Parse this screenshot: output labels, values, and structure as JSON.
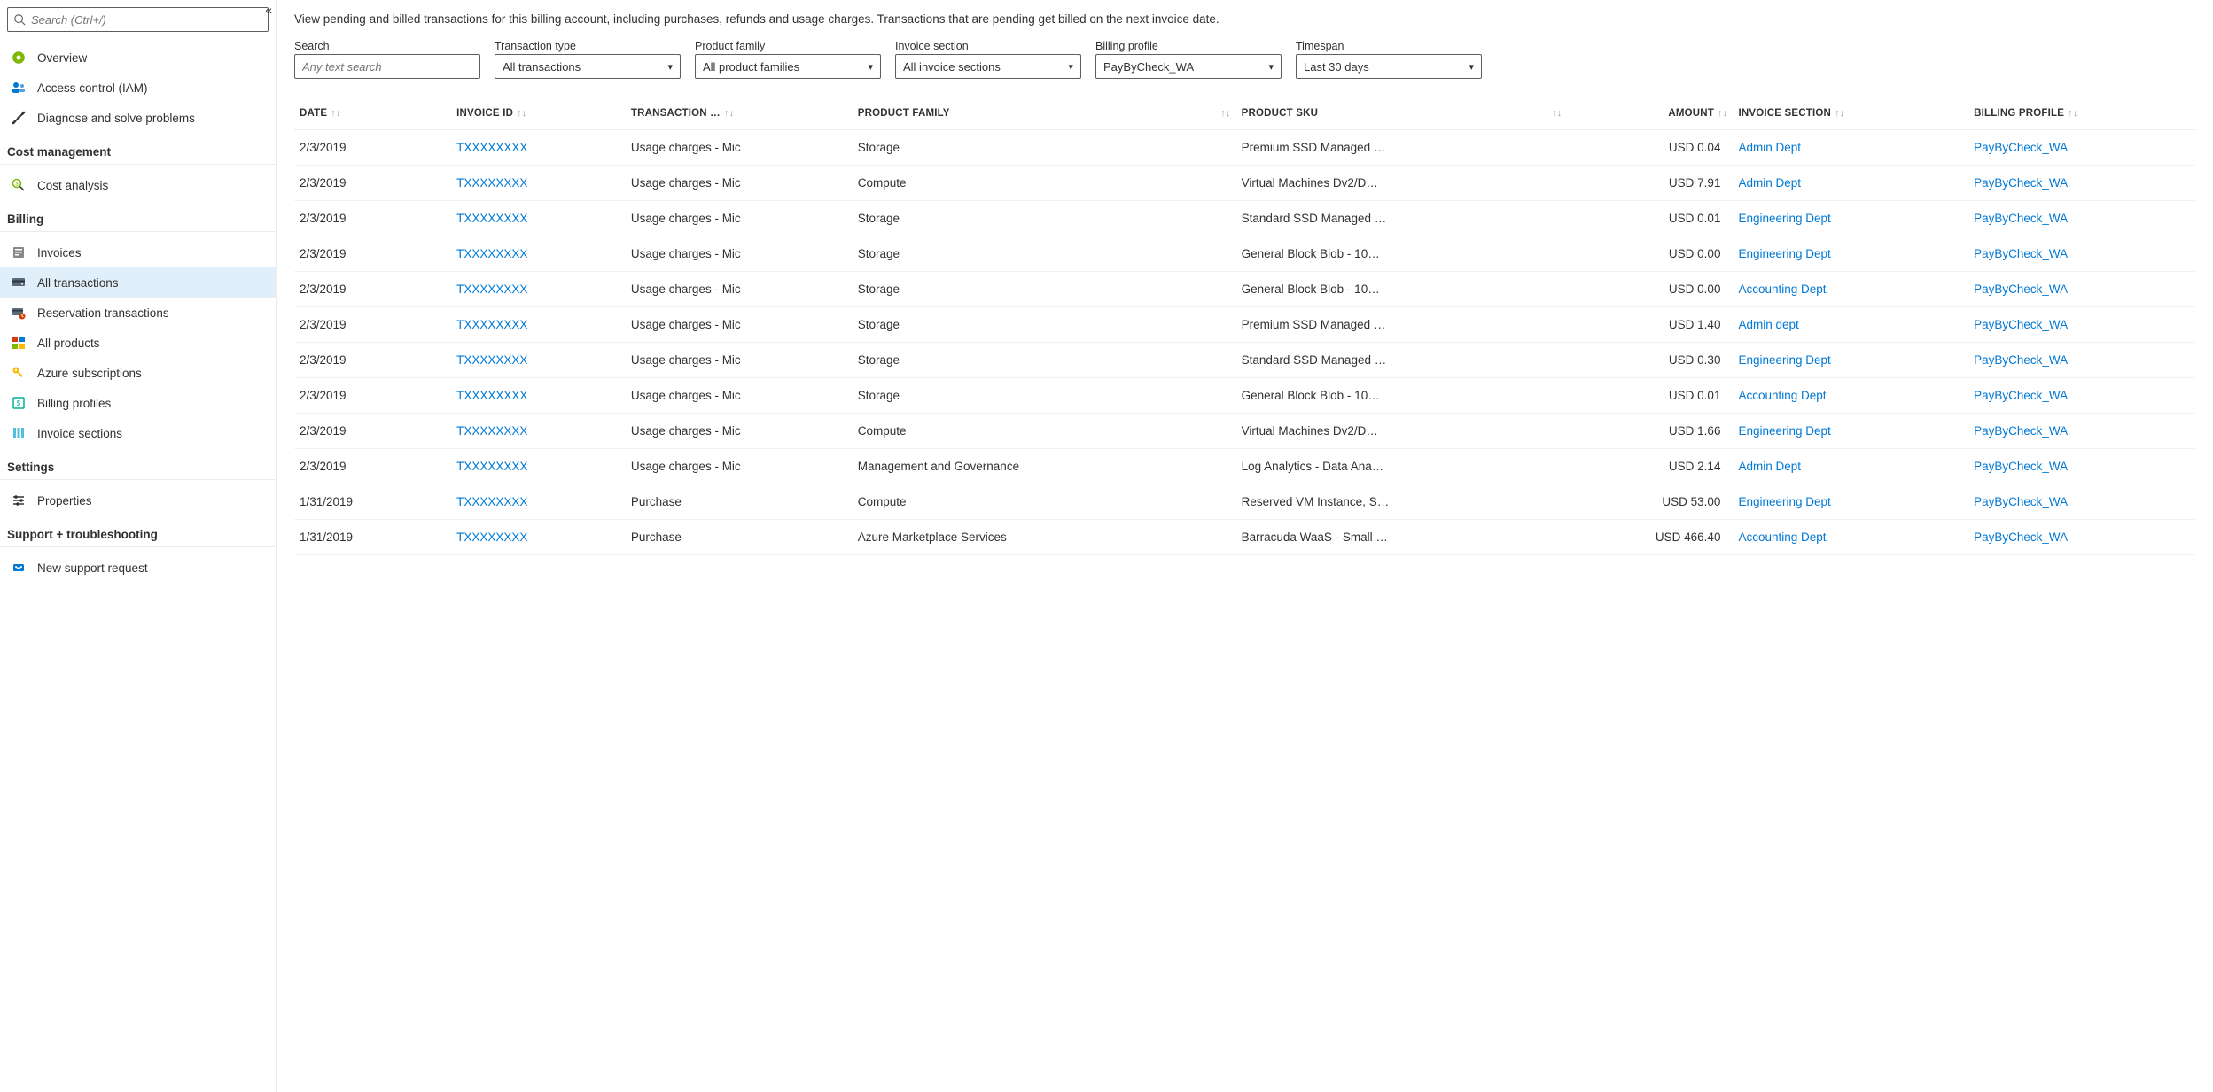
{
  "sidebar": {
    "search_placeholder": "Search (Ctrl+/)",
    "top_items": [
      {
        "label": "Overview"
      },
      {
        "label": "Access control (IAM)"
      },
      {
        "label": "Diagnose and solve problems"
      }
    ],
    "sections": [
      {
        "header": "Cost management",
        "items": [
          {
            "label": "Cost analysis"
          }
        ]
      },
      {
        "header": "Billing",
        "items": [
          {
            "label": "Invoices"
          },
          {
            "label": "All transactions",
            "active": true
          },
          {
            "label": "Reservation transactions"
          },
          {
            "label": "All products"
          },
          {
            "label": "Azure subscriptions"
          },
          {
            "label": "Billing profiles"
          },
          {
            "label": "Invoice sections"
          }
        ]
      },
      {
        "header": "Settings",
        "items": [
          {
            "label": "Properties"
          }
        ]
      },
      {
        "header": "Support + troubleshooting",
        "items": [
          {
            "label": "New support request"
          }
        ]
      }
    ]
  },
  "main": {
    "description": "View pending and billed transactions for this billing account, including purchases, refunds and usage charges. Transactions that are pending get billed on the next invoice date.",
    "filters": {
      "search_label": "Search",
      "search_placeholder": "Any text search",
      "transaction_type_label": "Transaction type",
      "transaction_type_value": "All transactions",
      "product_family_label": "Product family",
      "product_family_value": "All product families",
      "invoice_section_label": "Invoice section",
      "invoice_section_value": "All invoice sections",
      "billing_profile_label": "Billing profile",
      "billing_profile_value": "PayByCheck_WA",
      "timespan_label": "Timespan",
      "timespan_value": "Last 30 days"
    },
    "columns": [
      "DATE",
      "INVOICE ID",
      "TRANSACTION …",
      "PRODUCT FAMILY",
      "PRODUCT SKU",
      "AMOUNT",
      "INVOICE SECTION",
      "BILLING PROFILE"
    ],
    "rows": [
      {
        "date": "2/3/2019",
        "invoice_id": "TXXXXXXXX",
        "transaction": "Usage charges - Mic",
        "product_family": "Storage",
        "product_sku": "Premium SSD Managed …",
        "amount": "USD 0.04",
        "invoice_section": "Admin Dept",
        "billing_profile": "PayByCheck_WA"
      },
      {
        "date": "2/3/2019",
        "invoice_id": "TXXXXXXXX",
        "transaction": "Usage charges - Mic",
        "product_family": "Compute",
        "product_sku": "Virtual Machines Dv2/D…",
        "amount": "USD 7.91",
        "invoice_section": "Admin Dept",
        "billing_profile": "PayByCheck_WA"
      },
      {
        "date": "2/3/2019",
        "invoice_id": "TXXXXXXXX",
        "transaction": "Usage charges - Mic",
        "product_family": "Storage",
        "product_sku": "Standard SSD Managed …",
        "amount": "USD 0.01",
        "invoice_section": "Engineering Dept",
        "billing_profile": "PayByCheck_WA"
      },
      {
        "date": "2/3/2019",
        "invoice_id": "TXXXXXXXX",
        "transaction": "Usage charges - Mic",
        "product_family": "Storage",
        "product_sku": "General Block Blob - 10…",
        "amount": "USD 0.00",
        "invoice_section": "Engineering Dept",
        "billing_profile": "PayByCheck_WA"
      },
      {
        "date": "2/3/2019",
        "invoice_id": "TXXXXXXXX",
        "transaction": "Usage charges - Mic",
        "product_family": "Storage",
        "product_sku": "General Block Blob - 10…",
        "amount": "USD 0.00",
        "invoice_section": "Accounting Dept",
        "billing_profile": "PayByCheck_WA"
      },
      {
        "date": "2/3/2019",
        "invoice_id": "TXXXXXXXX",
        "transaction": "Usage charges - Mic",
        "product_family": "Storage",
        "product_sku": "Premium SSD Managed …",
        "amount": "USD 1.40",
        "invoice_section": "Admin dept",
        "billing_profile": "PayByCheck_WA"
      },
      {
        "date": "2/3/2019",
        "invoice_id": "TXXXXXXXX",
        "transaction": "Usage charges - Mic",
        "product_family": "Storage",
        "product_sku": "Standard SSD Managed …",
        "amount": "USD 0.30",
        "invoice_section": "Engineering Dept",
        "billing_profile": "PayByCheck_WA"
      },
      {
        "date": "2/3/2019",
        "invoice_id": "TXXXXXXXX",
        "transaction": "Usage charges - Mic",
        "product_family": "Storage",
        "product_sku": "General Block Blob - 10…",
        "amount": "USD 0.01",
        "invoice_section": "Accounting Dept",
        "billing_profile": "PayByCheck_WA"
      },
      {
        "date": "2/3/2019",
        "invoice_id": "TXXXXXXXX",
        "transaction": "Usage charges - Mic",
        "product_family": "Compute",
        "product_sku": "Virtual Machines Dv2/D…",
        "amount": "USD 1.66",
        "invoice_section": "Engineering Dept",
        "billing_profile": "PayByCheck_WA"
      },
      {
        "date": "2/3/2019",
        "invoice_id": "TXXXXXXXX",
        "transaction": "Usage charges - Mic",
        "product_family": "Management and Governance",
        "product_sku": "Log Analytics - Data Ana…",
        "amount": "USD 2.14",
        "invoice_section": "Admin Dept",
        "billing_profile": "PayByCheck_WA"
      },
      {
        "date": "1/31/2019",
        "invoice_id": "TXXXXXXXX",
        "transaction": "Purchase",
        "product_family": "Compute",
        "product_sku": "Reserved VM Instance, S…",
        "amount": "USD 53.00",
        "invoice_section": "Engineering Dept",
        "billing_profile": "PayByCheck_WA"
      },
      {
        "date": "1/31/2019",
        "invoice_id": "TXXXXXXXX",
        "transaction": "Purchase",
        "product_family": "Azure Marketplace Services",
        "product_sku": "Barracuda WaaS - Small …",
        "amount": "USD 466.40",
        "invoice_section": "Accounting Dept",
        "billing_profile": "PayByCheck_WA"
      }
    ]
  }
}
